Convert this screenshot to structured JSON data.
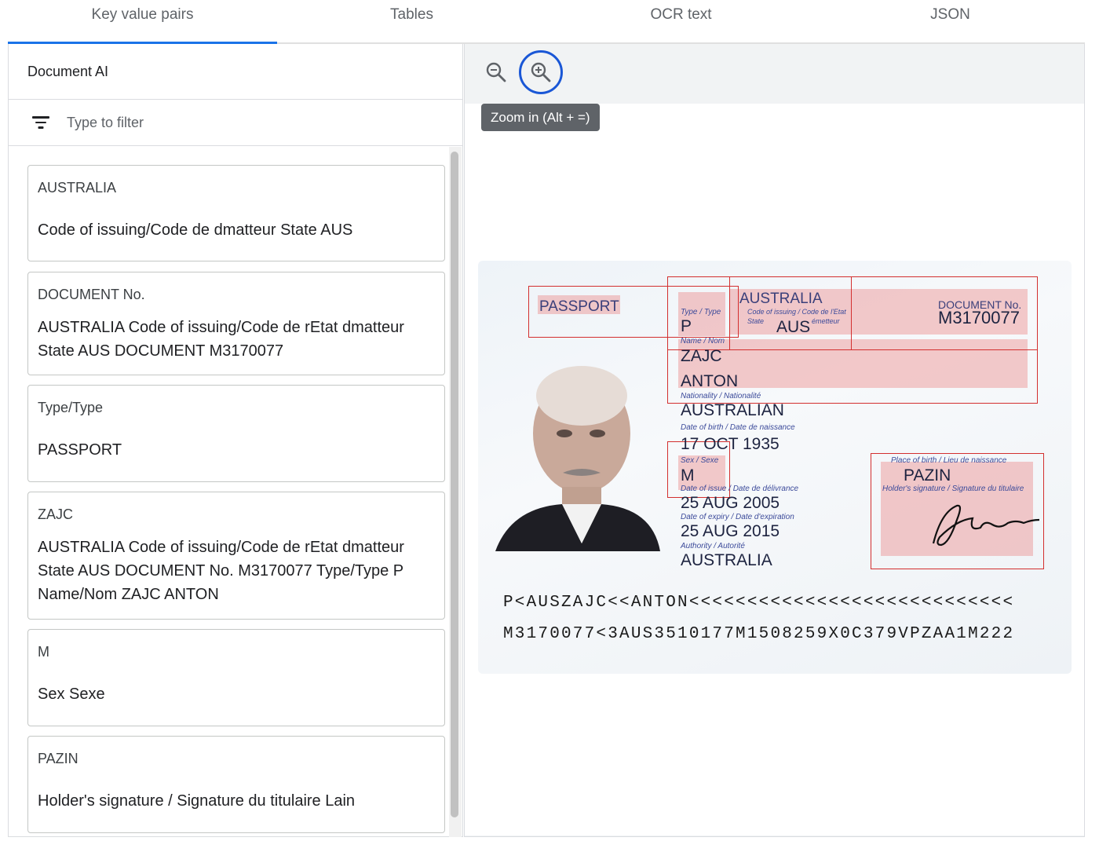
{
  "tabs": [
    "Key value pairs",
    "Tables",
    "OCR text",
    "JSON"
  ],
  "active_tab": "Key value pairs",
  "left_panel": {
    "title": "Document AI",
    "filter_placeholder": "Type to filter",
    "cards": [
      {
        "key": "AUSTRALIA",
        "value": "Code of issuing/Code de dmatteur State AUS"
      },
      {
        "key": "DOCUMENT No.",
        "value": "AUSTRALIA Code of issuing/Code de rEtat dmatteur State AUS DOCUMENT M3170077"
      },
      {
        "key": "Type/Type",
        "value": "PASSPORT"
      },
      {
        "key": "ZAJC",
        "value": "AUSTRALIA Code of issuing/Code de rEtat dmatteur State AUS DOCUMENT No. M3170077 Type/Type P Name/Nom ZAJC ANTON"
      },
      {
        "key": "M",
        "value": "Sex Sexe"
      },
      {
        "key": "PAZIN",
        "value": "Holder's signature / Signature du titulaire Lain"
      }
    ]
  },
  "viewer": {
    "tooltip": "Zoom in (Alt + =)",
    "passport": {
      "passport_label": "PASSPORT",
      "type_caption": "Type / Type",
      "type_value": "P",
      "country": "AUSTRALIA",
      "code_caption": "Code of issuing / Code de l'Etat",
      "state_caption": "State",
      "emetteur_caption": "émetteur",
      "state_value": "AUS",
      "doc_caption": "DOCUMENT No.",
      "doc_value": "M3170077",
      "name_caption": "Name / Nom",
      "surname": "ZAJC",
      "given_name": "ANTON",
      "nationality_caption": "Nationality / Nationalité",
      "nationality": "AUSTRALIAN",
      "dob_caption": "Date of birth / Date de naissance",
      "dob": "17 OCT 1935",
      "sex_caption": "Sex / Sexe",
      "sex": "M",
      "issue_caption": "Date of issue / Date de délivrance",
      "issue": "25 AUG 2005",
      "expiry_caption": "Date of expiry / Date d'expiration",
      "expiry": "25 AUG 2015",
      "authority_caption": "Authority / Autorité",
      "authority": "AUSTRALIA",
      "pob_caption": "Place of birth / Lieu de naissance",
      "pob": "PAZIN",
      "sig_caption": "Holder's signature / Signature du titulaire",
      "mrz1": "P<AUSZAJC<<ANTON<<<<<<<<<<<<<<<<<<<<<<<<<<<<",
      "mrz2": "M3170077<3AUS3510177M1508259X0C379VPZAA1M222"
    }
  },
  "colors": {
    "accent": "#1a73e8",
    "highlight_box": "#d32f2f",
    "tooltip_bg": "#5f6368"
  },
  "icons": [
    "zoom-out-icon",
    "zoom-in-icon",
    "filter-icon"
  ]
}
